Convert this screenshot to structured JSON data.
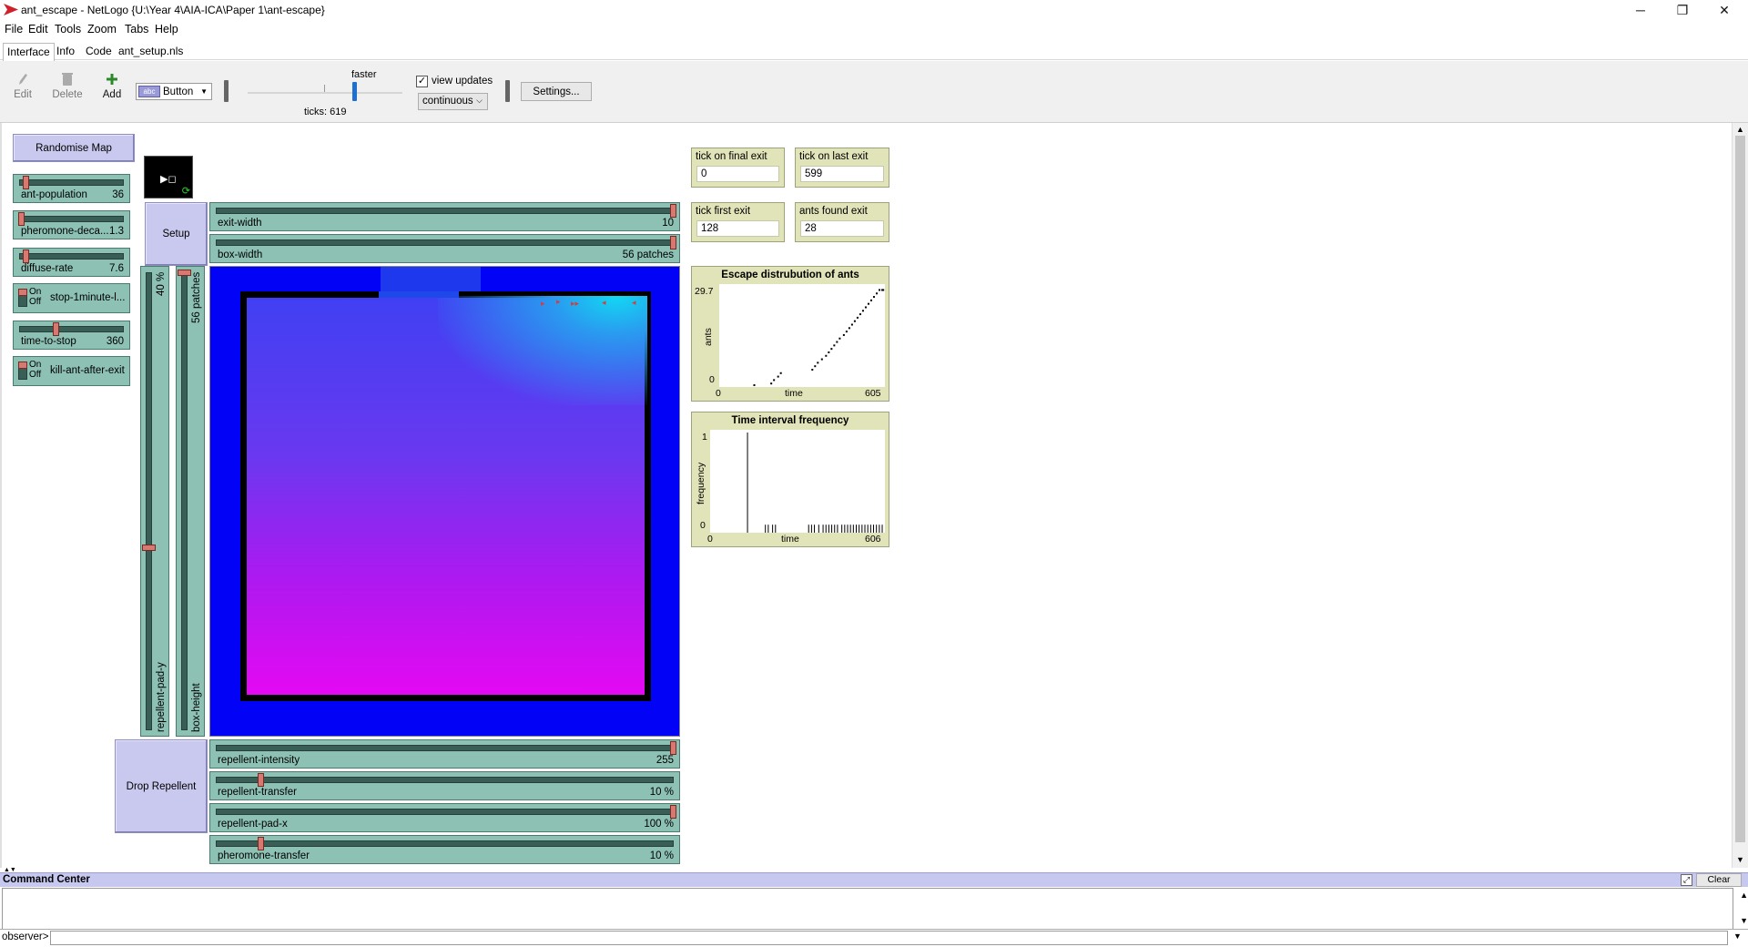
{
  "window": {
    "title": "ant_escape - NetLogo {U:\\Year 4\\AIA-ICA\\Paper 1\\ant-escape}",
    "minimize": "─",
    "restore": "❐",
    "close": "✕"
  },
  "menu": {
    "items": [
      {
        "label": "File",
        "underline": "F"
      },
      {
        "label": "Edit",
        "underline": "E"
      },
      {
        "label": "Tools",
        "underline": "T"
      },
      {
        "label": "Zoom",
        "underline": "Z"
      },
      {
        "label": "Tabs",
        "underline": "T"
      },
      {
        "label": "Help",
        "underline": "H"
      }
    ]
  },
  "tabs": [
    "Interface",
    "Info",
    "Code",
    "ant_setup.nls"
  ],
  "toolbar": {
    "edit": "Edit",
    "delete": "Delete",
    "add": "Add",
    "widget_type": "Button",
    "speed_label": "faster",
    "ticks": "ticks: 619",
    "view_updates": "view updates",
    "update_mode": "continuous",
    "settings": "Settings..."
  },
  "buttons": {
    "randomise_map": "Randomise Map",
    "setup": "Setup",
    "drop_repellent": "Drop Repellent"
  },
  "sliders": {
    "ant_population": {
      "label": "ant-population",
      "value": "36",
      "fraction": 0.04
    },
    "pheromone_decay": {
      "label": "pheromone-deca...",
      "value": "1.3",
      "fraction": 0.0
    },
    "diffuse_rate": {
      "label": "diffuse-rate",
      "value": "7.6",
      "fraction": 0.05
    },
    "time_to_stop": {
      "label": "time-to-stop",
      "value": "360",
      "fraction": 0.3
    },
    "exit_width": {
      "label": "exit-width",
      "value": "10",
      "fraction": 1.0
    },
    "box_width": {
      "label": "box-width",
      "value": "56 patches",
      "fraction": 1.0
    },
    "repellent_intensity": {
      "label": "repellent-intensity",
      "value": "255",
      "fraction": 1.0
    },
    "repellent_transfer": {
      "label": "repellent-transfer",
      "value": "10 %",
      "fraction": 0.1
    },
    "repellent_pad_x": {
      "label": "repellent-pad-x",
      "value": "100 %",
      "fraction": 1.0
    },
    "pheromone_transfer": {
      "label": "pheromone-transfer",
      "value": "10 %",
      "fraction": 0.1
    },
    "repellent_pad_y": {
      "label": "repellent-pad-y",
      "value": "40 %",
      "fraction": 0.4
    },
    "box_height": {
      "label": "box-height",
      "value": "56 patches",
      "fraction": 1.0
    }
  },
  "switches": {
    "stop_1minute": {
      "label": "stop-1minute-l...",
      "on": "On",
      "off": "Off"
    },
    "kill_ant": {
      "label": "kill-ant-after-exit",
      "on": "On",
      "off": "Off"
    }
  },
  "monitors": {
    "tick_final_exit": {
      "label": "tick on final exit",
      "value": "0"
    },
    "tick_last_exit": {
      "label": "tick on last exit",
      "value": "599"
    },
    "tick_first_exit": {
      "label": "tick first exit",
      "value": "128"
    },
    "ants_found_exit": {
      "label": "ants found exit",
      "value": "28"
    }
  },
  "chart_data": [
    {
      "type": "scatter",
      "title": "Escape distrubution of ants",
      "xlabel": "time",
      "ylabel": "ants",
      "xlim": [
        0,
        605
      ],
      "ylim": [
        0,
        29.7
      ],
      "xmin_label": "0",
      "xmax_label": "605",
      "ymin_label": "0",
      "ymax_label": "29.7",
      "x": [
        128,
        190,
        200,
        215,
        225,
        340,
        350,
        360,
        375,
        390,
        400,
        410,
        420,
        430,
        440,
        455,
        465,
        475,
        485,
        495,
        505,
        515,
        525,
        535,
        545,
        555,
        565,
        575,
        585,
        595,
        599
      ],
      "y": [
        0,
        1,
        2,
        3,
        4,
        5,
        6,
        7,
        8,
        9,
        10,
        11,
        12,
        13,
        14,
        15,
        16,
        17,
        18,
        19,
        20,
        21,
        22,
        23,
        24,
        25,
        26,
        27,
        28,
        28,
        28
      ]
    },
    {
      "type": "bar",
      "title": "Time interval frequency",
      "xlabel": "time",
      "ylabel": "frequency",
      "xlim": [
        0,
        606
      ],
      "ylim": [
        0,
        1
      ],
      "xmin_label": "0",
      "xmax_label": "606",
      "ymin_label": "0",
      "ymax_label": "1",
      "x": [
        128,
        190,
        200,
        215,
        225,
        340,
        350,
        360,
        375,
        390,
        400,
        410,
        420,
        430,
        440,
        455,
        465,
        475,
        485,
        495,
        505,
        515,
        525,
        535,
        545,
        555,
        565,
        575,
        585,
        595
      ],
      "values": [
        1,
        0.08,
        0.08,
        0.08,
        0.08,
        0.08,
        0.08,
        0.08,
        0.08,
        0.08,
        0.08,
        0.08,
        0.08,
        0.08,
        0.08,
        0.08,
        0.08,
        0.08,
        0.08,
        0.08,
        0.08,
        0.08,
        0.08,
        0.08,
        0.08,
        0.08,
        0.08,
        0.08,
        0.08,
        0.08
      ]
    }
  ],
  "command_center": {
    "title": "Command Center",
    "clear": "Clear",
    "observer": "observer>"
  }
}
